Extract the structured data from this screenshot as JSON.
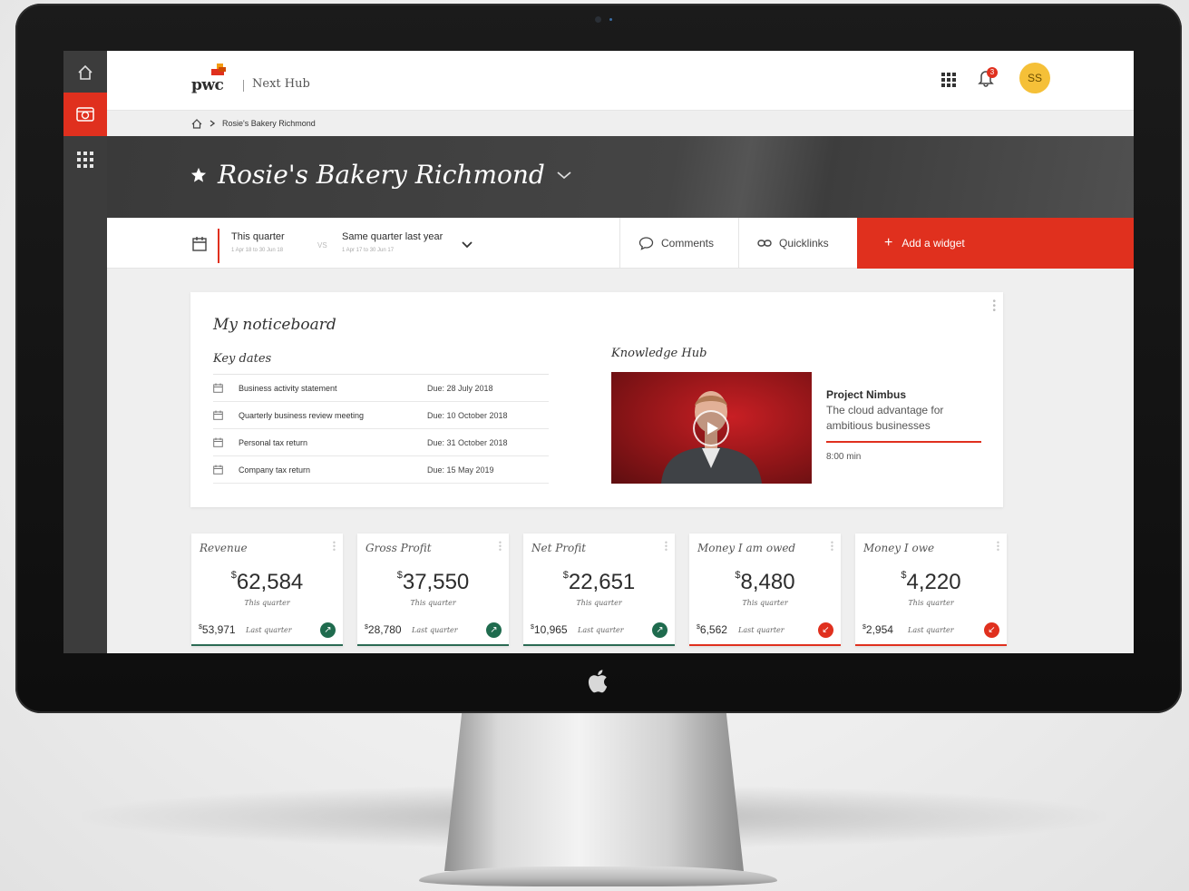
{
  "app": {
    "logo": "pwc",
    "name": "Next Hub"
  },
  "header": {
    "notifications_count": "3",
    "avatar_initials": "SS"
  },
  "breadcrumb": {
    "current": "Rosie's Bakery Richmond"
  },
  "page": {
    "title": "Rosie's Bakery Richmond"
  },
  "controls": {
    "period": "This quarter",
    "period_range": "1 Apr 18 to 30 Jun 18",
    "vs": "VS",
    "compare": "Same quarter last year",
    "compare_range": "1 Apr 17 to 30 Jun 17",
    "comments": "Comments",
    "quicklinks": "Quicklinks",
    "add_widget": "Add a widget"
  },
  "noticeboard": {
    "title": "My noticeboard",
    "key_dates_title": "Key dates",
    "key_dates": [
      {
        "name": "Business activity statement",
        "due": "Due: 28 July 2018"
      },
      {
        "name": "Quarterly business review meeting",
        "due": "Due: 10 October 2018"
      },
      {
        "name": "Personal tax return",
        "due": "Due: 31 October 2018"
      },
      {
        "name": "Company tax return",
        "due": "Due: 15 May 2019"
      }
    ],
    "knowledge_hub_title": "Knowledge Hub",
    "video": {
      "title": "Project Nimbus",
      "subtitle": "The cloud advantage for ambitious businesses",
      "duration": "8:00 min"
    }
  },
  "metrics": [
    {
      "title": "Revenue",
      "currency": "$",
      "value": "62,584",
      "period": "This quarter",
      "last_value": "53,971",
      "last_label": "Last quarter",
      "trend": "up"
    },
    {
      "title": "Gross Profit",
      "currency": "$",
      "value": "37,550",
      "period": "This quarter",
      "last_value": "28,780",
      "last_label": "Last quarter",
      "trend": "up"
    },
    {
      "title": "Net Profit",
      "currency": "$",
      "value": "22,651",
      "period": "This quarter",
      "last_value": "10,965",
      "last_label": "Last quarter",
      "trend": "up"
    },
    {
      "title": "Money I am owed",
      "currency": "$",
      "value": "8,480",
      "period": "This quarter",
      "last_value": "6,562",
      "last_label": "Last quarter",
      "trend": "down"
    },
    {
      "title": "Money I owe",
      "currency": "$",
      "value": "4,220",
      "period": "This quarter",
      "last_value": "2,954",
      "last_label": "Last quarter",
      "trend": "down"
    }
  ],
  "colors": {
    "accent": "#e0301e",
    "positive": "#1f6b4e",
    "avatar": "#f5c038",
    "hero": "#444444"
  },
  "icons": [
    "home-icon",
    "dashboard-icon",
    "apps-grid-icon",
    "bell-icon",
    "star-icon",
    "chevron-down-icon",
    "calendar-icon",
    "comment-icon",
    "link-icon",
    "plus-icon",
    "play-icon",
    "more-icon",
    "trend-up-icon",
    "trend-down-icon",
    "apple-logo"
  ]
}
